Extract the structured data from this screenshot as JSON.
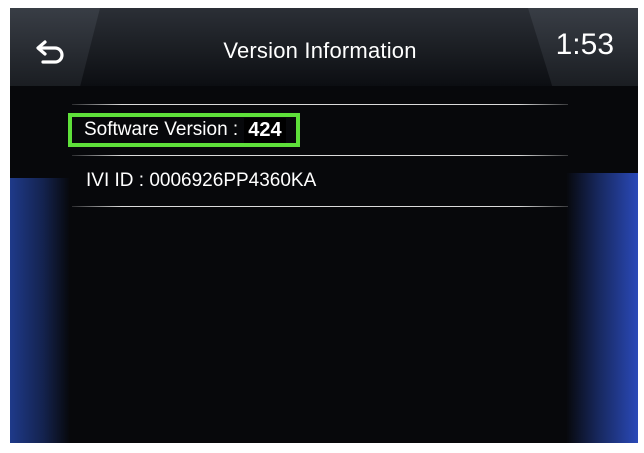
{
  "header": {
    "title": "Version Information",
    "clock": "1:53",
    "back_icon": "back-arrow-icon"
  },
  "rows": {
    "software_version": {
      "label": "Software Version :",
      "value": "424"
    },
    "ivi_id": {
      "text": "IVI ID : 0006926PP4360KA"
    }
  },
  "colors": {
    "highlight_border": "#5ee03a",
    "accent_blue": "#2a49b8"
  }
}
